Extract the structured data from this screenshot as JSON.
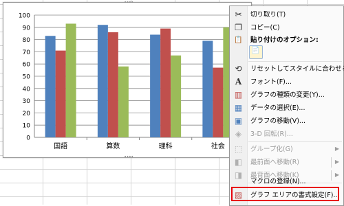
{
  "chart_data": {
    "type": "bar",
    "categories": [
      "国語",
      "算数",
      "理科",
      "社会"
    ],
    "series": [
      {
        "values": [
          83,
          92,
          84,
          79
        ],
        "color": "#4f81bd"
      },
      {
        "values": [
          71,
          86,
          89,
          57
        ],
        "color": "#c0504d"
      },
      {
        "values": [
          93,
          58,
          67,
          90
        ],
        "color": "#9bbb59"
      }
    ],
    "ylim": [
      0,
      100
    ],
    "yticks": [
      0,
      10,
      20,
      30,
      40,
      50,
      60,
      70,
      80,
      90,
      100
    ],
    "grid": true
  },
  "context_menu": {
    "items": [
      {
        "icon": "scissors-icon",
        "glyph": "✂",
        "label": "切り取り(T)",
        "disabled": false
      },
      {
        "icon": "copy-icon",
        "glyph": "❐",
        "label": "コピー(C)",
        "disabled": false
      },
      {
        "icon": "paste-options-icon",
        "glyph": "📋",
        "label": "貼り付けのオプション:",
        "disabled": false,
        "header": true
      },
      {
        "icon": "reset-style-icon",
        "glyph": "⟲",
        "label": "リセットしてスタイルに合わせる(A)",
        "disabled": false
      },
      {
        "icon": "font-icon",
        "glyph": "A",
        "label": "フォント(F)...",
        "disabled": false
      },
      {
        "icon": "change-chart-type-icon",
        "glyph": "▥",
        "label": "グラフの種類の変更(Y)...",
        "disabled": false
      },
      {
        "icon": "select-data-icon",
        "glyph": "▦",
        "label": "データの選択(E)...",
        "disabled": false
      },
      {
        "icon": "move-chart-icon",
        "glyph": "▣",
        "label": "グラフの移動(V)...",
        "disabled": false
      },
      {
        "icon": "3d-rotation-icon",
        "glyph": "◈",
        "label": "3-D 回転(R)...",
        "disabled": true
      },
      {
        "icon": "group-icon",
        "glyph": "⬚",
        "label": "グループ化(G)",
        "disabled": true,
        "submenu": true
      },
      {
        "icon": "bring-to-front-icon",
        "glyph": "◧",
        "label": "最前面へ移動(R)",
        "disabled": true,
        "submenu": true
      },
      {
        "icon": "send-to-back-icon",
        "glyph": "◨",
        "label": "最背面へ移動(K)",
        "disabled": true,
        "submenu": true
      },
      {
        "icon": "",
        "glyph": "",
        "label": "マクロの登録(N)...",
        "disabled": false
      },
      {
        "icon": "format-chart-area-icon",
        "glyph": "▨",
        "label": "グラフ エリアの書式設定(F)...",
        "disabled": false
      }
    ],
    "paste_option_glyph": "📄"
  }
}
